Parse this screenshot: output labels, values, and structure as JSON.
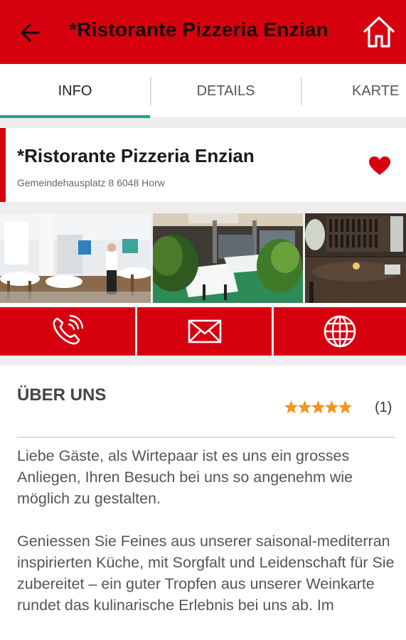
{
  "appbar": {
    "title": "*Ristorante Pizzeria Enzian",
    "back_icon": "arrow-left-icon",
    "home_icon": "home-icon",
    "color": "#d7000f"
  },
  "tabs": [
    {
      "label": "INFO",
      "active": true
    },
    {
      "label": "DETAILS",
      "active": false
    },
    {
      "label": "KARTE",
      "active": false
    }
  ],
  "tab_indicator_color": "#2a9d8f",
  "place": {
    "name": "*Ristorante Pizzeria Enzian",
    "address": "Gemeindehausplatz 8 6048 Horw",
    "favorite": true,
    "favorite_icon": "heart-icon"
  },
  "photos": [
    {
      "subject": "dining-room-with-waiter"
    },
    {
      "subject": "terrace-with-plants"
    },
    {
      "subject": "wine-bar-interior"
    }
  ],
  "actions": [
    {
      "icon": "phone-icon"
    },
    {
      "icon": "mail-icon"
    },
    {
      "icon": "globe-icon"
    }
  ],
  "about": {
    "title": "ÜBER UNS",
    "rating_stars": 5,
    "rating_count": "(1)",
    "star_color": "#f7941d",
    "paragraphs": [
      "Liebe Gäste, als Wirtepaar ist es uns ein grosses Anliegen, Ihren Besuch bei uns so angenehm wie möglich zu gestalten.",
      "Geniessen Sie Feines aus unserer saisonal-mediterran inspirierten Küche, mit Sorgfalt und Leidenschaft für Sie zubereitet – ein guter Tropfen aus unserer Weinkarte rundet das kulinarische Erlebnis bei uns ab. Im"
    ]
  }
}
